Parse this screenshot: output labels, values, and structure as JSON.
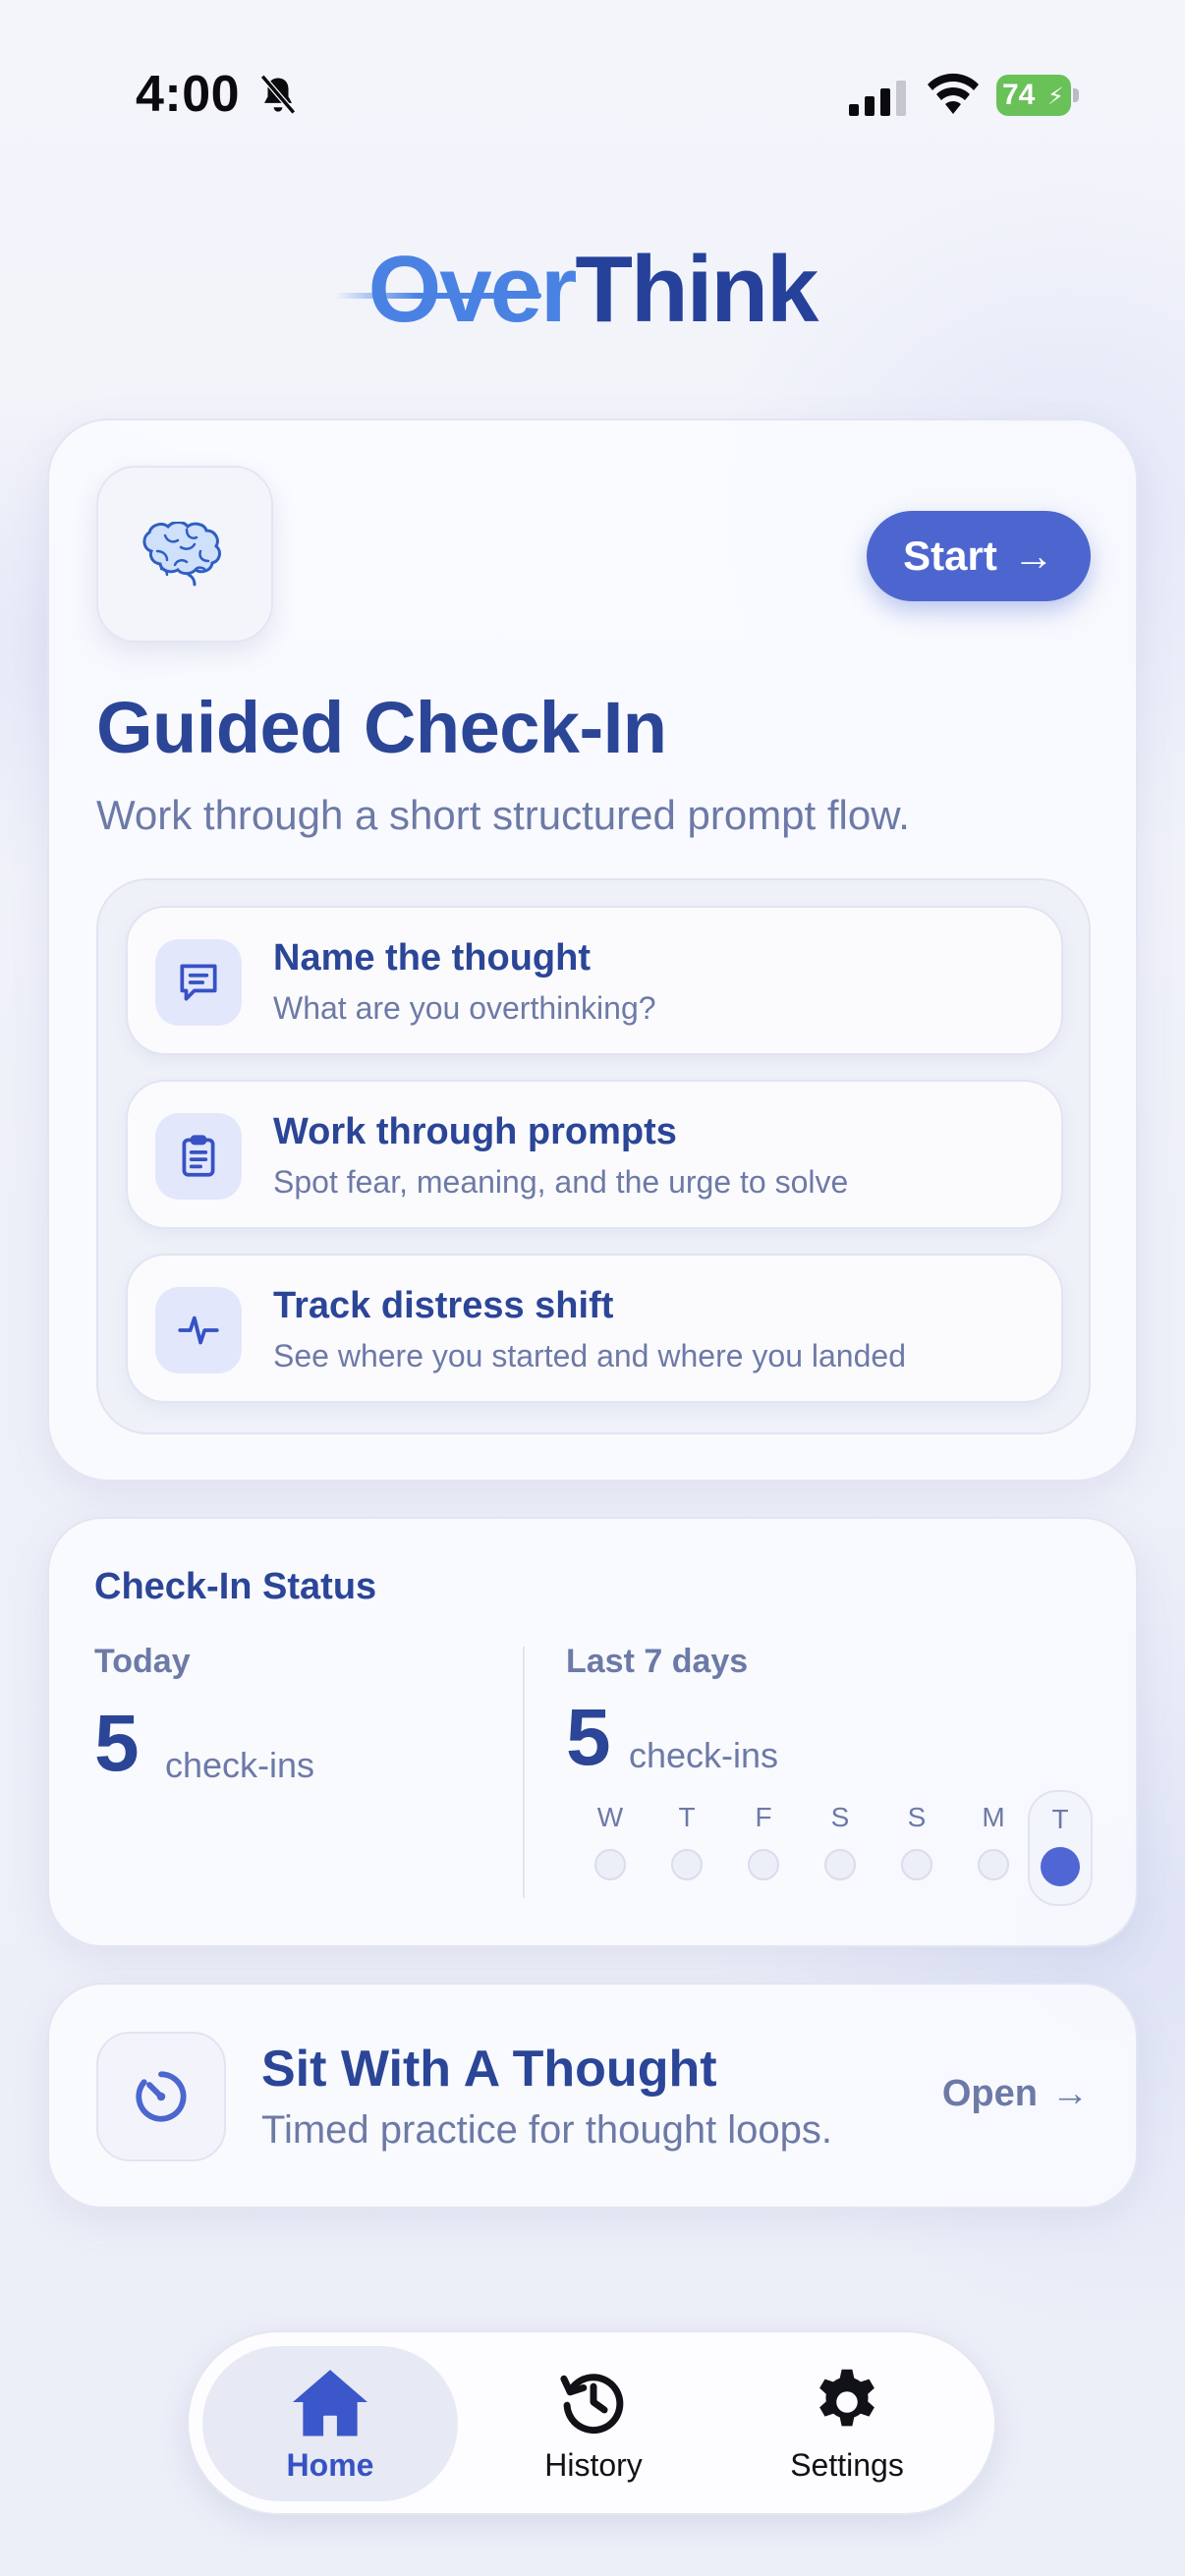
{
  "status_bar": {
    "time": "4:00",
    "battery": "74",
    "icons": [
      "bell-slash-icon",
      "signal-icon",
      "wifi-icon",
      "battery-charging-icon"
    ]
  },
  "logo": {
    "part1": "Over",
    "part2": "Think"
  },
  "guided_checkin": {
    "icon": "brain-icon",
    "start_label": "Start",
    "start_arrow": "→",
    "title": "Guided Check-In",
    "subtitle": "Work through a short structured prompt flow.",
    "steps": [
      {
        "icon": "message-icon",
        "title": "Name the thought",
        "desc": "What are you overthinking?"
      },
      {
        "icon": "clipboard-icon",
        "title": "Work through prompts",
        "desc": "Spot fear, meaning, and the urge to solve"
      },
      {
        "icon": "pulse-icon",
        "title": "Track distress shift",
        "desc": "See where you started and where you landed"
      }
    ]
  },
  "checkin_status": {
    "title": "Check-In Status",
    "today_label": "Today",
    "today_count": "5",
    "today_unit": "check-ins",
    "week_label": "Last 7 days",
    "week_count": "5",
    "week_unit": "check-ins",
    "days": [
      "W",
      "T",
      "F",
      "S",
      "S",
      "M",
      "T"
    ],
    "active_day_index": 6
  },
  "sit_with_thought": {
    "icon": "timer-icon",
    "title": "Sit With A Thought",
    "subtitle": "Timed practice for thought loops.",
    "open_label": "Open",
    "open_arrow": "→"
  },
  "tabbar": {
    "tabs": [
      {
        "label": "Home",
        "icon": "home-icon",
        "active": true
      },
      {
        "label": "History",
        "icon": "history-icon",
        "active": false
      },
      {
        "label": "Settings",
        "icon": "gear-icon",
        "active": false
      }
    ]
  },
  "colors": {
    "accent": "#4d66cf",
    "title": "#2b4597",
    "muted": "#6d7aa7",
    "logo_light": "#4a82e4",
    "battery": "#69c158"
  }
}
